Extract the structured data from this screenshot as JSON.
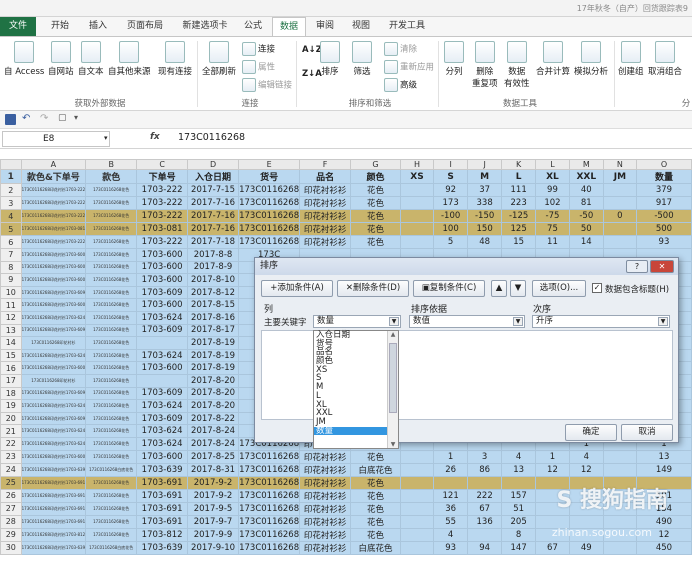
{
  "title_bar": {
    "text": "17年秋冬（自产）回货跟踪表9"
  },
  "tabs": [
    "文件",
    "开始",
    "插入",
    "页面布局",
    "新建选项卡",
    "公式",
    "数据",
    "审阅",
    "视图",
    "开发工具"
  ],
  "ribbon": {
    "get_external": {
      "access": "自 Access",
      "web": "自网站",
      "text": "自文本",
      "other": "自其他来源",
      "existing": "现有连接",
      "group": "获取外部数据"
    },
    "connections": {
      "refresh": "全部刷新",
      "conn": "连接",
      "props": "属性",
      "edit_links": "编辑链接",
      "group": "连接"
    },
    "sort_filter": {
      "sort": "排序",
      "filter": "筛选",
      "clear": "清除",
      "reapply": "重新应用",
      "advanced": "高级",
      "group": "排序和筛选"
    },
    "data_tools": {
      "split": "分列",
      "remove_dup_1": "删除",
      "remove_dup_2": "重复项",
      "validation_1": "数据",
      "validation_2": "有效性",
      "consolidate": "合并计算",
      "whatif": "模拟分析",
      "group": "数据工具"
    },
    "outline": {
      "group_btn": "创建组",
      "ungroup": "取消组合",
      "subtotal": "分"
    }
  },
  "formula_bar": {
    "name_box": "E8",
    "fx": "fx",
    "value": "173C0116268"
  },
  "columns": [
    "",
    "A",
    "B",
    "C",
    "D",
    "E",
    "F",
    "G",
    "H",
    "I",
    "J",
    "K",
    "L",
    "M",
    "N",
    "O"
  ],
  "header_row": [
    "款色&下单号",
    "款色",
    "下单号",
    "入仓日期",
    "货号",
    "品名",
    "颜色",
    "XS",
    "S",
    "M",
    "L",
    "XL",
    "XXL",
    "JM",
    "数量"
  ],
  "rows": [
    {
      "n": "2",
      "a": "173C0116268印花衬衫1703-222",
      "b": "173C0116268花色",
      "c": "1703-222",
      "d": "2017-7-15",
      "e": "173C0116268",
      "f": "印花衬衫衫",
      "g": "花色",
      "h": "",
      "i": "92",
      "j": "37",
      "k": "111",
      "l": "99",
      "m": "40",
      "nn": "",
      "o": "379"
    },
    {
      "n": "3",
      "a": "173C0116268印花衬衫1703-222",
      "b": "173C0116268花色",
      "c": "1703-222",
      "d": "2017-7-16",
      "e": "173C0116268",
      "f": "印花衬衫衫",
      "g": "花色",
      "h": "",
      "i": "173",
      "j": "338",
      "k": "223",
      "l": "102",
      "m": "81",
      "nn": "",
      "o": "917"
    },
    {
      "n": "4",
      "a": "173C0116268印花衬衫1703-222",
      "b": "173C0116268花色",
      "c": "1703-222",
      "d": "2017-7-16",
      "e": "173C0116268",
      "f": "印花衬衫衫",
      "g": "花色",
      "h": "",
      "i": "-100",
      "j": "-150",
      "k": "-125",
      "l": "-75",
      "m": "-50",
      "nn": "0",
      "o": "-500",
      "style": "olive"
    },
    {
      "n": "5",
      "a": "173C0116268印花衬衫1703-081",
      "b": "173C0116268花色",
      "c": "1703-081",
      "d": "2017-7-16",
      "e": "173C0116268",
      "f": "印花衬衫衫",
      "g": "花色",
      "h": "",
      "i": "100",
      "j": "150",
      "k": "125",
      "l": "75",
      "m": "50",
      "nn": "",
      "o": "500",
      "style": "olive"
    },
    {
      "n": "6",
      "a": "173C0116268印花衬衫1703-222",
      "b": "173C0116268花色",
      "c": "1703-222",
      "d": "2017-7-18",
      "e": "173C0116268",
      "f": "印花衬衫衫",
      "g": "花色",
      "h": "",
      "i": "5",
      "j": "48",
      "k": "15",
      "l": "11",
      "m": "14",
      "nn": "",
      "o": "93"
    },
    {
      "n": "7",
      "a": "173C0116268印花衬衫1703-600",
      "b": "173C0116268花色",
      "c": "1703-600",
      "d": "2017-8-8",
      "e": "173C",
      "f": "",
      "g": "",
      "h": "",
      "i": "",
      "j": "",
      "k": "",
      "l": "",
      "m": "",
      "nn": "",
      "o": ""
    },
    {
      "n": "8",
      "a": "173C0116268印花衬衫1703-600",
      "b": "173C0116268花色",
      "c": "1703-600",
      "d": "2017-8-9",
      "e": "173C",
      "f": "",
      "g": "",
      "h": "",
      "i": "",
      "j": "",
      "k": "",
      "l": "",
      "m": "",
      "nn": "",
      "o": ""
    },
    {
      "n": "9",
      "a": "173C0116268印花衬衫1703-600",
      "b": "173C0116268花色",
      "c": "1703-600",
      "d": "2017-8-10",
      "e": "173C",
      "f": "",
      "g": "",
      "h": "",
      "i": "",
      "j": "",
      "k": "",
      "l": "",
      "m": "",
      "nn": "",
      "o": ""
    },
    {
      "n": "10",
      "a": "173C0116268印花衬衫1703-609",
      "b": "173C0116268花色",
      "c": "1703-609",
      "d": "2017-8-12",
      "e": "173C",
      "f": "",
      "g": "",
      "h": "",
      "i": "",
      "j": "",
      "k": "",
      "l": "",
      "m": "",
      "nn": "",
      "o": ""
    },
    {
      "n": "11",
      "a": "173C0116268印花衬衫1703-600",
      "b": "173C0116268花色",
      "c": "1703-600",
      "d": "2017-8-15",
      "e": "173C",
      "f": "",
      "g": "",
      "h": "",
      "i": "",
      "j": "",
      "k": "",
      "l": "",
      "m": "",
      "nn": "",
      "o": ""
    },
    {
      "n": "12",
      "a": "173C0116268印花衬衫1703-624",
      "b": "173C0116268花色",
      "c": "1703-624",
      "d": "2017-8-16",
      "e": "173C",
      "f": "",
      "g": "",
      "h": "",
      "i": "",
      "j": "",
      "k": "",
      "l": "",
      "m": "",
      "nn": "",
      "o": ""
    },
    {
      "n": "13",
      "a": "173C0116268印花衬衫1703-609",
      "b": "173C0116268花色",
      "c": "1703-609",
      "d": "2017-8-17",
      "e": "173C",
      "f": "",
      "g": "",
      "h": "",
      "i": "",
      "j": "",
      "k": "",
      "l": "",
      "m": "",
      "nn": "",
      "o": ""
    },
    {
      "n": "14",
      "a": "173C0116268印花衬衫",
      "b": "173C0116268花色",
      "c": "",
      "d": "2017-8-19",
      "e": "173C",
      "f": "",
      "g": "",
      "h": "",
      "i": "",
      "j": "",
      "k": "",
      "l": "",
      "m": "",
      "nn": "",
      "o": ""
    },
    {
      "n": "15",
      "a": "173C0116268印花衬衫1703-624",
      "b": "173C0116268花色",
      "c": "1703-624",
      "d": "2017-8-19",
      "e": "173C",
      "f": "",
      "g": "",
      "h": "",
      "i": "",
      "j": "",
      "k": "",
      "l": "",
      "m": "",
      "nn": "",
      "o": ""
    },
    {
      "n": "16",
      "a": "173C0116268印花衬衫1703-600",
      "b": "173C0116268花色",
      "c": "1703-600",
      "d": "2017-8-19",
      "e": "173C",
      "f": "",
      "g": "",
      "h": "",
      "i": "",
      "j": "",
      "k": "",
      "l": "",
      "m": "",
      "nn": "",
      "o": ""
    },
    {
      "n": "17",
      "a": "173C0116268印花衬衫",
      "b": "173C0116268花色",
      "c": "",
      "d": "2017-8-20",
      "e": "173C",
      "f": "",
      "g": "",
      "h": "",
      "i": "",
      "j": "",
      "k": "",
      "l": "",
      "m": "",
      "nn": "",
      "o": ""
    },
    {
      "n": "18",
      "a": "173C0116268印花衬衫1703-609",
      "b": "173C0116268花色",
      "c": "1703-609",
      "d": "2017-8-20",
      "e": "173C",
      "f": "",
      "g": "",
      "h": "",
      "i": "",
      "j": "",
      "k": "",
      "l": "",
      "m": "",
      "nn": "",
      "o": ""
    },
    {
      "n": "19",
      "a": "173C0116268印花衬衫1703-624",
      "b": "173C0116268花色",
      "c": "1703-624",
      "d": "2017-8-20",
      "e": "173C",
      "f": "",
      "g": "",
      "h": "",
      "i": "",
      "j": "",
      "k": "",
      "l": "",
      "m": "",
      "nn": "",
      "o": ""
    },
    {
      "n": "20",
      "a": "173C0116268印花衬衫1703-609",
      "b": "173C0116268花色",
      "c": "1703-609",
      "d": "2017-8-22",
      "e": "173C",
      "f": "",
      "g": "",
      "h": "",
      "i": "",
      "j": "",
      "k": "",
      "l": "",
      "m": "",
      "nn": "",
      "o": ""
    },
    {
      "n": "21",
      "a": "173C0116268印花衬衫1703-624",
      "b": "173C0116268花色",
      "c": "1703-624",
      "d": "2017-8-24",
      "e": "173C",
      "f": "",
      "g": "",
      "h": "",
      "i": "",
      "j": "",
      "k": "",
      "l": "",
      "m": "",
      "nn": "",
      "o": ""
    },
    {
      "n": "22",
      "a": "173C0116268印花衬衫1703-624",
      "b": "173C0116268花色",
      "c": "1703-624",
      "d": "2017-8-24",
      "e": "173C0116268",
      "f": "印花衬衫衫",
      "g": "花色",
      "h": "",
      "i": "",
      "j": "",
      "k": "",
      "l": "",
      "m": "1",
      "nn": "",
      "o": "1"
    },
    {
      "n": "23",
      "a": "173C0116268印花衬衫1703-600",
      "b": "173C0116268花色",
      "c": "1703-600",
      "d": "2017-8-25",
      "e": "173C0116268",
      "f": "印花衬衫衫",
      "g": "花色",
      "h": "",
      "i": "1",
      "j": "3",
      "k": "4",
      "l": "1",
      "m": "4",
      "nn": "",
      "o": "13"
    },
    {
      "n": "24",
      "a": "173C0116268印花衬衫1703-639",
      "b": "173C0116268白底花色",
      "c": "1703-639",
      "d": "2017-8-31",
      "e": "173C0116268",
      "f": "印花衬衫衫",
      "g": "白底花色",
      "h": "",
      "i": "26",
      "j": "86",
      "k": "13",
      "l": "12",
      "m": "12",
      "nn": "",
      "o": "149"
    },
    {
      "n": "25",
      "a": "173C0116268印花衬衫1703-691",
      "b": "173C0116268花色",
      "c": "1703-691",
      "d": "2017-9-2",
      "e": "173C0116268",
      "f": "印花衬衫衫",
      "g": "花色",
      "h": "",
      "i": "",
      "j": "",
      "k": "",
      "l": "",
      "m": "",
      "nn": "",
      "o": "",
      "style": "olive"
    },
    {
      "n": "26",
      "a": "173C0116268印花衬衫1703-691",
      "b": "173C0116268花色",
      "c": "1703-691",
      "d": "2017-9-2",
      "e": "173C0116268",
      "f": "印花衬衫衫",
      "g": "花色",
      "h": "",
      "i": "121",
      "j": "222",
      "k": "157",
      "l": "",
      "m": "",
      "nn": "",
      "o": "501"
    },
    {
      "n": "27",
      "a": "173C0116268印花衬衫1703-691",
      "b": "173C0116268花色",
      "c": "1703-691",
      "d": "2017-9-5",
      "e": "173C0116268",
      "f": "印花衬衫衫",
      "g": "花色",
      "h": "",
      "i": "36",
      "j": "67",
      "k": "51",
      "l": "",
      "m": "",
      "nn": "",
      "o": "154"
    },
    {
      "n": "28",
      "a": "173C0116268印花衬衫1703-691",
      "b": "173C0116268花色",
      "c": "1703-691",
      "d": "2017-9-7",
      "e": "173C0116268",
      "f": "印花衬衫衫",
      "g": "花色",
      "h": "",
      "i": "55",
      "j": "136",
      "k": "205",
      "l": "",
      "m": "",
      "nn": "",
      "o": "490"
    },
    {
      "n": "29",
      "a": "173C0116268印花衬衫1703-812",
      "b": "173C0116268花色",
      "c": "1703-812",
      "d": "2017-9-9",
      "e": "173C0116268",
      "f": "印花衬衫衫",
      "g": "花色",
      "h": "",
      "i": "4",
      "j": "",
      "k": "8",
      "l": "",
      "m": "",
      "nn": "",
      "o": "12"
    },
    {
      "n": "30",
      "a": "173C0116268印花衬衫1703-639",
      "b": "173C0116268白底花色",
      "c": "1703-639",
      "d": "2017-9-10",
      "e": "173C0116268",
      "f": "印花衬衫衫",
      "g": "白底花色",
      "h": "",
      "i": "93",
      "j": "94",
      "k": "147",
      "l": "67",
      "m": "49",
      "nn": "",
      "o": "450"
    }
  ],
  "sort_dialog": {
    "title": "排序",
    "add_level": "添加条件(A)",
    "delete_level": "删除条件(D)",
    "copy_level": "复制条件(C)",
    "options": "选项(O)...",
    "has_header": "数据包含标题(H)",
    "col_header": "列",
    "sort_on_header": "排序依据",
    "order_header": "次序",
    "main_key_label": "主要关键字",
    "main_key_value": "数量",
    "sort_on_value": "数值",
    "order_value": "升序",
    "ok": "确定",
    "cancel": "取消",
    "help": "?",
    "close": "✕",
    "dropdown_items": [
      "入仓日期",
      "货号",
      "品名",
      "颜色",
      "XS",
      "S",
      "M",
      "L",
      "XL",
      "XXL",
      "JM",
      "数量"
    ],
    "dropdown_selected": "数量"
  },
  "watermark": {
    "main": "S 搜狗指南",
    "sub": "zhinan.sogou.com"
  }
}
